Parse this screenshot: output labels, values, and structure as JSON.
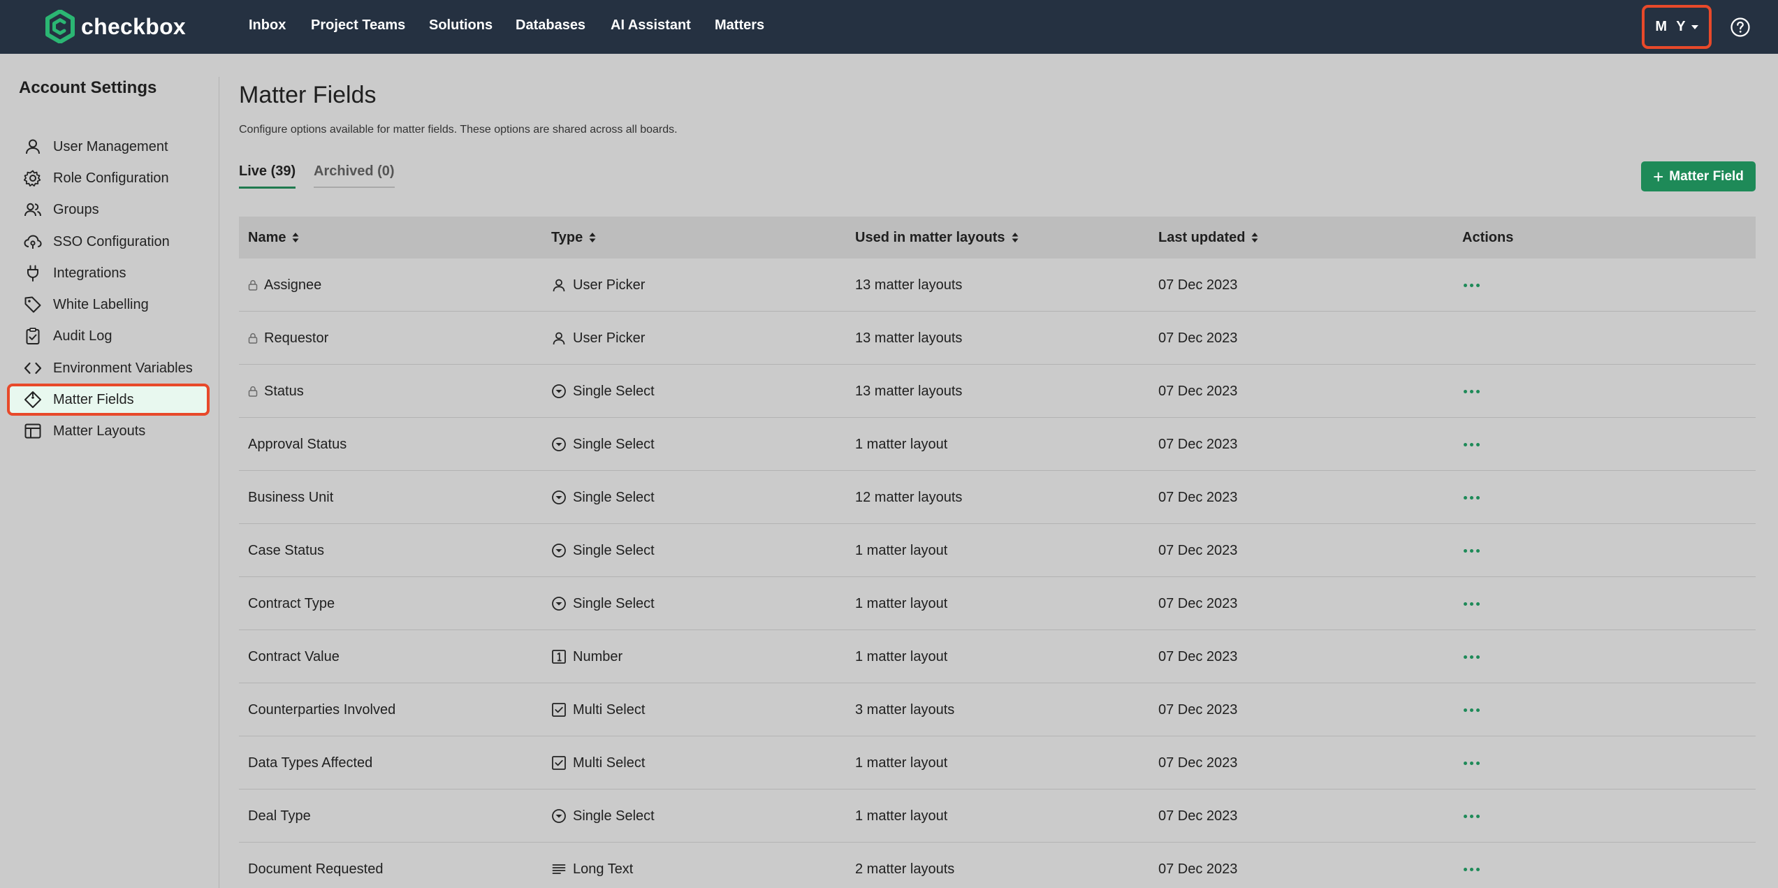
{
  "brand": {
    "name": "checkbox",
    "logo_icon": "checkbox-logo-icon",
    "accent": "#2bb673"
  },
  "nav": {
    "links": [
      "Inbox",
      "Project Teams",
      "Solutions",
      "Databases",
      "AI Assistant",
      "Matters"
    ],
    "user_initials": "M Y",
    "user_caret_icon": "caret-down-icon",
    "help_icon": "question-circle-icon"
  },
  "sidebar": {
    "title": "Account Settings",
    "items": [
      {
        "label": "User Management",
        "icon": "user-icon"
      },
      {
        "label": "Role Configuration",
        "icon": "gear-icon"
      },
      {
        "label": "Groups",
        "icon": "users-icon"
      },
      {
        "label": "SSO Configuration",
        "icon": "cloud-key-icon"
      },
      {
        "label": "Integrations",
        "icon": "plug-icon"
      },
      {
        "label": "White Labelling",
        "icon": "tag-icon"
      },
      {
        "label": "Audit Log",
        "icon": "clipboard-check-icon"
      },
      {
        "label": "Environment Variables",
        "icon": "code-icon"
      },
      {
        "label": "Matter Fields",
        "icon": "diamond-tag-icon",
        "active": true
      },
      {
        "label": "Matter Layouts",
        "icon": "layout-icon"
      }
    ]
  },
  "main": {
    "title": "Matter Fields",
    "description": "Configure options available for matter fields. These options are shared across all boards.",
    "tabs": [
      {
        "label": "Live (39)",
        "active": true
      },
      {
        "label": "Archived (0)",
        "active": false
      }
    ],
    "add_button_label": "Matter Field",
    "table": {
      "columns": [
        "Name",
        "Type",
        "Used in matter layouts",
        "Last updated",
        "Actions"
      ],
      "rows": [
        {
          "name": "Assignee",
          "locked": true,
          "type": "User Picker",
          "type_icon": "user-icon",
          "used": "13 matter layouts",
          "updated": "07 Dec 2023",
          "actions": true
        },
        {
          "name": "Requestor",
          "locked": true,
          "type": "User Picker",
          "type_icon": "user-icon",
          "used": "13 matter layouts",
          "updated": "07 Dec 2023",
          "actions": false
        },
        {
          "name": "Status",
          "locked": true,
          "type": "Single Select",
          "type_icon": "chevron-circle-icon",
          "used": "13 matter layouts",
          "updated": "07 Dec 2023",
          "actions": true
        },
        {
          "name": "Approval Status",
          "locked": false,
          "type": "Single Select",
          "type_icon": "chevron-circle-icon",
          "used": "1 matter layout",
          "updated": "07 Dec 2023",
          "actions": true
        },
        {
          "name": "Business Unit",
          "locked": false,
          "type": "Single Select",
          "type_icon": "chevron-circle-icon",
          "used": "12 matter layouts",
          "updated": "07 Dec 2023",
          "actions": true
        },
        {
          "name": "Case Status",
          "locked": false,
          "type": "Single Select",
          "type_icon": "chevron-circle-icon",
          "used": "1 matter layout",
          "updated": "07 Dec 2023",
          "actions": true
        },
        {
          "name": "Contract Type",
          "locked": false,
          "type": "Single Select",
          "type_icon": "chevron-circle-icon",
          "used": "1 matter layout",
          "updated": "07 Dec 2023",
          "actions": true
        },
        {
          "name": "Contract Value",
          "locked": false,
          "type": "Number",
          "type_icon": "number-box-icon",
          "used": "1 matter layout",
          "updated": "07 Dec 2023",
          "actions": true
        },
        {
          "name": "Counterparties Involved",
          "locked": false,
          "type": "Multi Select",
          "type_icon": "checkbox-icon",
          "used": "3 matter layouts",
          "updated": "07 Dec 2023",
          "actions": true
        },
        {
          "name": "Data Types Affected",
          "locked": false,
          "type": "Multi Select",
          "type_icon": "checkbox-icon",
          "used": "1 matter layout",
          "updated": "07 Dec 2023",
          "actions": true
        },
        {
          "name": "Deal Type",
          "locked": false,
          "type": "Single Select",
          "type_icon": "chevron-circle-icon",
          "used": "1 matter layout",
          "updated": "07 Dec 2023",
          "actions": true
        },
        {
          "name": "Document Requested",
          "locked": false,
          "type": "Long Text",
          "type_icon": "lines-icon",
          "used": "2 matter layouts",
          "updated": "07 Dec 2023",
          "actions": true
        }
      ]
    }
  }
}
